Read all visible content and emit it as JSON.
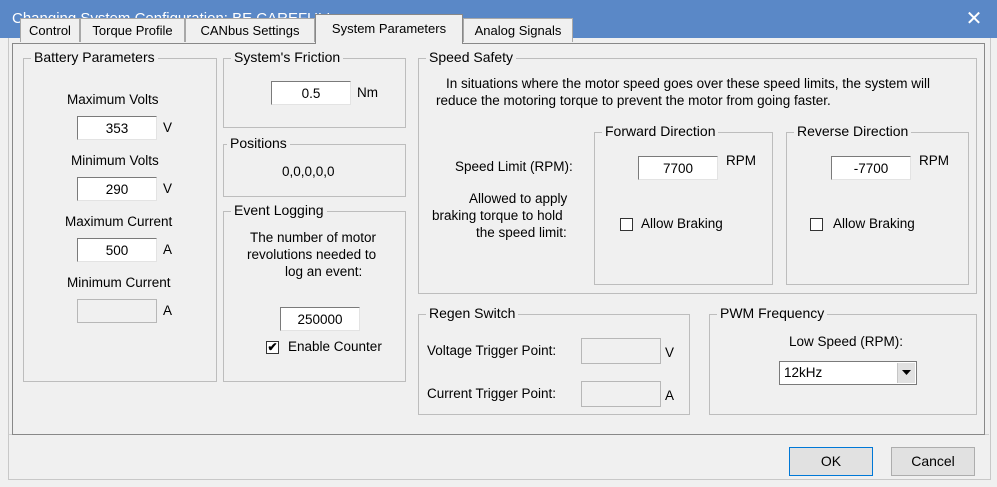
{
  "window": {
    "title": "Changing System Configuration: BE CAREFUL!",
    "close_glyph": "✕"
  },
  "tabs": [
    "Control",
    "Torque Profile",
    "CANbus Settings",
    "System Parameters",
    "Analog Signals"
  ],
  "battery": {
    "title": "Battery Parameters",
    "max_volts_label": "Maximum Volts",
    "max_volts_value": "353",
    "max_volts_unit": "V",
    "min_volts_label": "Minimum Volts",
    "min_volts_value": "290",
    "min_volts_unit": "V",
    "max_current_label": "Maximum Current",
    "max_current_value": "500",
    "max_current_unit": "A",
    "min_current_label": "Minimum Current",
    "min_current_value": "",
    "min_current_unit": "A"
  },
  "friction": {
    "title": "System's Friction",
    "value": "0.5",
    "unit": "Nm"
  },
  "positions": {
    "title": "Positions",
    "value": "0,0,0,0,0"
  },
  "event_logging": {
    "title": "Event Logging",
    "desc_lines": [
      "The number of motor",
      "revolutions needed to",
      "log an event:"
    ],
    "value": "250000",
    "enable_label": "Enable Counter",
    "enable_checked": true
  },
  "speed_safety": {
    "title": "Speed Safety",
    "desc_lines": [
      "In situations where the motor speed goes over these speed limits, the system will",
      "reduce the motoring torque to prevent the motor from going faster."
    ],
    "speed_limit_label": "Speed Limit (RPM):",
    "braking_lines": [
      "Allowed to apply",
      "braking torque to hold",
      "the speed limit:"
    ],
    "forward": {
      "title": "Forward Direction",
      "value": "7700",
      "unit": "RPM",
      "allow_label": "Allow Braking",
      "allow_checked": false
    },
    "reverse": {
      "title": "Reverse Direction",
      "value": "-7700",
      "unit": "RPM",
      "allow_label": "Allow Braking",
      "allow_checked": false
    }
  },
  "regen": {
    "title": "Regen Switch",
    "voltage_label": "Voltage Trigger Point:",
    "voltage_value": "",
    "voltage_unit": "V",
    "current_label": "Current Trigger Point:",
    "current_value": "",
    "current_unit": "A"
  },
  "pwm": {
    "title": "PWM Frequency",
    "label": "Low Speed (RPM):",
    "selected": "12kHz"
  },
  "buttons": {
    "ok": "OK",
    "cancel": "Cancel"
  }
}
